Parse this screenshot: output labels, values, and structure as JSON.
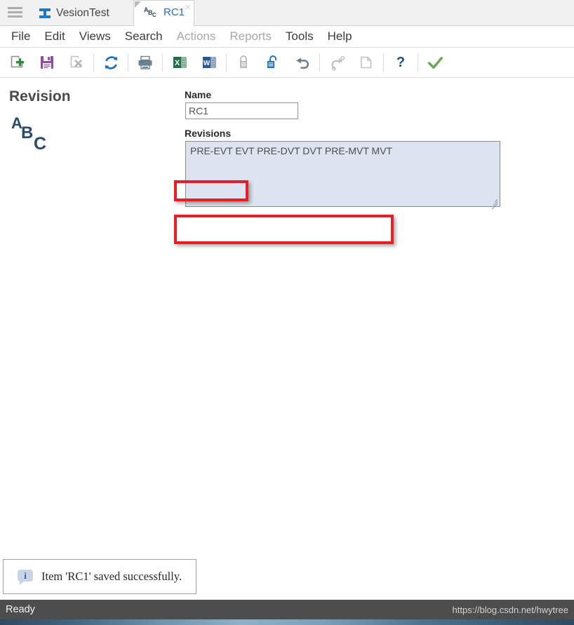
{
  "tabstrip": {
    "hamburger_icon": "hamburger-menu-icon",
    "app_logo_icon": "ibeam-logo-icon",
    "app_title": "VesionTest",
    "document_tab": {
      "icon": "abc-revision-icon",
      "label": "RC1",
      "close_label": "×",
      "letters": {
        "a": "A",
        "b": "B",
        "c": "C"
      }
    }
  },
  "menubar": {
    "items": [
      {
        "label": "File",
        "disabled": false
      },
      {
        "label": "Edit",
        "disabled": false
      },
      {
        "label": "Views",
        "disabled": false
      },
      {
        "label": "Search",
        "disabled": false
      },
      {
        "label": "Actions",
        "disabled": true
      },
      {
        "label": "Reports",
        "disabled": true
      },
      {
        "label": "Tools",
        "disabled": false
      },
      {
        "label": "Help",
        "disabled": false
      }
    ]
  },
  "toolbar": {
    "items": [
      {
        "name": "new-item-icon",
        "title": "New",
        "disabled": false
      },
      {
        "name": "save-icon",
        "title": "Save",
        "disabled": false
      },
      {
        "name": "delete-item-icon",
        "title": "Delete",
        "disabled": true
      },
      {
        "name": "refresh-icon",
        "title": "Refresh",
        "disabled": false
      },
      {
        "name": "print-icon",
        "title": "Print",
        "disabled": false
      },
      {
        "name": "export-excel-icon",
        "title": "Export to Excel",
        "disabled": false
      },
      {
        "name": "export-word-icon",
        "title": "Export to Word",
        "disabled": false
      },
      {
        "name": "lock-icon",
        "title": "Lock",
        "disabled": true
      },
      {
        "name": "unlock-icon",
        "title": "Unlock",
        "disabled": false
      },
      {
        "name": "undo-icon",
        "title": "Undo",
        "disabled": false
      },
      {
        "name": "redo-icon",
        "title": "Redo",
        "disabled": true
      },
      {
        "name": "copy-icon",
        "title": "Copy",
        "disabled": true
      },
      {
        "name": "help-icon",
        "title": "Help",
        "disabled": false
      },
      {
        "name": "apply-checkmark-icon",
        "title": "Apply",
        "disabled": false
      }
    ]
  },
  "form": {
    "heading": "Revision",
    "type_icon": {
      "a": "A",
      "b": "B",
      "c": "C"
    },
    "name": {
      "label": "Name",
      "value": "RC1",
      "placeholder": "Name"
    },
    "revisions": {
      "label": "Revisions",
      "value": "PRE-EVT EVT PRE-DVT DVT PRE-MVT MVT",
      "placeholder": "Revisions"
    }
  },
  "annotations": [
    {
      "name": "name-field-highlight",
      "color": "#ec1c24"
    },
    {
      "name": "revisions-field-highlight",
      "color": "#ec1c24"
    }
  ],
  "toast": {
    "icon": "info-icon",
    "icon_glyph": "i",
    "message": "Item 'RC1' saved successfully."
  },
  "statusbar": {
    "left_text": "Ready",
    "right_text": "https://blog.csdn.net/hwytree"
  },
  "colors": {
    "accent_blue": "#1e7bc1",
    "tab_label_blue": "#2a6ebb",
    "annotation_red": "#ec1c24",
    "textarea_bg": "#dde4f0",
    "statusbar_bg": "#4d4d4d",
    "excel_green": "#1e7145",
    "word_blue": "#2b579a",
    "abc_icon_blue": "#2b4a6f"
  }
}
